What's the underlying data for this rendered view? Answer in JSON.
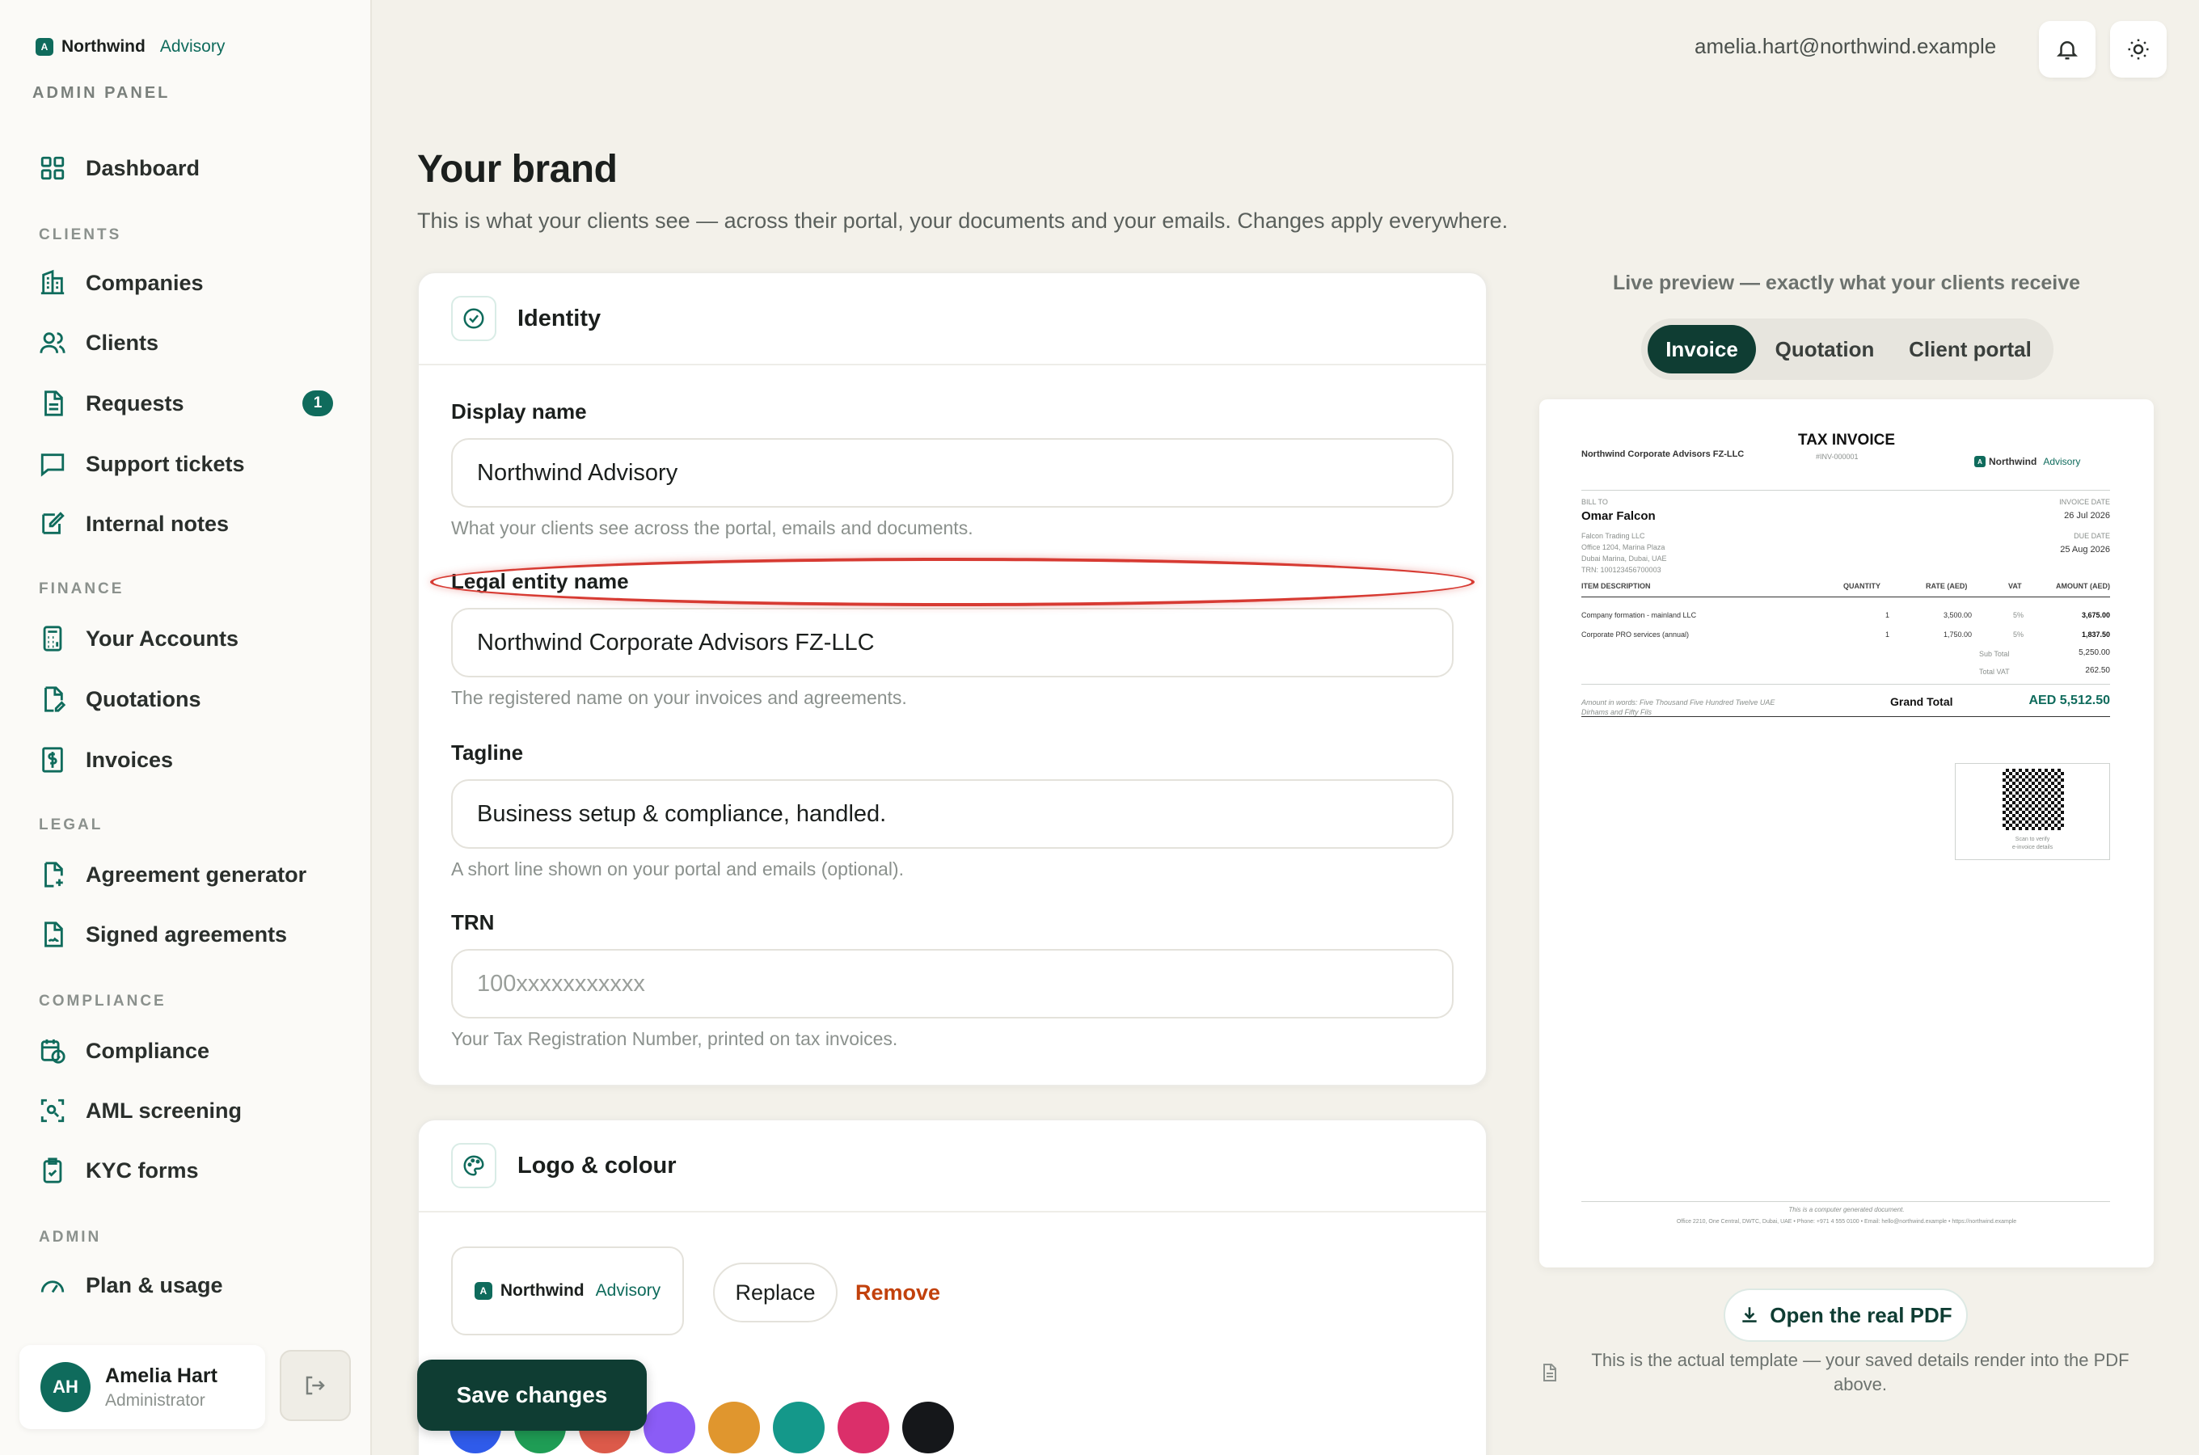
{
  "brand": {
    "logo_letter": "A",
    "name": "Northwind",
    "accent": "Advisory"
  },
  "admin_label": "ADMIN PANEL",
  "sidebar": {
    "dashboard": "Dashboard",
    "sections": {
      "clients": "CLIENTS",
      "finance": "FINANCE",
      "legal": "LEGAL",
      "compliance": "COMPLIANCE",
      "admin": "ADMIN"
    },
    "items": {
      "companies": "Companies",
      "clients": "Clients",
      "requests": "Requests",
      "requests_badge": "1",
      "support_tickets": "Support tickets",
      "internal_notes": "Internal notes",
      "your_accounts": "Your Accounts",
      "quotations": "Quotations",
      "invoices": "Invoices",
      "agreement_generator": "Agreement generator",
      "signed_agreements": "Signed agreements",
      "compliance": "Compliance",
      "aml_screening": "AML screening",
      "kyc_forms": "KYC forms",
      "plan_usage": "Plan & usage"
    }
  },
  "user": {
    "initials": "AH",
    "name": "Amelia Hart",
    "role": "Administrator"
  },
  "topbar": {
    "email": "amelia.hart@northwind.example"
  },
  "page": {
    "title": "Your brand",
    "subtitle": "This is what your clients see — across their portal, your documents and your emails. Changes apply everywhere."
  },
  "identity": {
    "title": "Identity",
    "display_name": {
      "label": "Display name",
      "value": "Northwind Advisory",
      "help": "What your clients see across the portal, emails and documents."
    },
    "legal_name": {
      "label": "Legal entity name",
      "value": "Northwind Corporate Advisors FZ-LLC",
      "help": "The registered name on your invoices and agreements."
    },
    "tagline": {
      "label": "Tagline",
      "value": "Business setup & compliance, handled.",
      "help": "A short line shown on your portal and emails (optional)."
    },
    "trn": {
      "label": "TRN",
      "value": "",
      "placeholder": "100xxxxxxxxxxx",
      "help": "Your Tax Registration Number, printed on tax invoices."
    }
  },
  "logo_colour": {
    "title": "Logo & colour",
    "replace": "Replace",
    "remove": "Remove",
    "swatches": [
      "#2f5bea",
      "#1f9d55",
      "#dc5a4a",
      "#8b5cf6",
      "#e0962e",
      "#14988a",
      "#db2f6a",
      "#15171a"
    ]
  },
  "save_button": "Save changes",
  "preview": {
    "caption": "Live preview — exactly what your clients receive",
    "tabs": {
      "invoice": "Invoice",
      "quotation": "Quotation",
      "client_portal": "Client portal"
    },
    "open_pdf": "Open the real PDF",
    "note": "This is the actual template — your saved details render into the PDF above."
  },
  "invoice_doc": {
    "company": "Northwind Corporate Advisors FZ-LLC",
    "title": "TAX INVOICE",
    "number": "#INV-000001",
    "bill_to_label": "BILL TO",
    "client_name": "Omar Falcon",
    "client_company": "Falcon Trading LLC",
    "client_addr1": "Office 1204, Marina Plaza",
    "client_addr2": "Dubai Marina, Dubai, UAE",
    "client_trn": "TRN: 100123456700003",
    "invoice_date_label": "INVOICE DATE",
    "invoice_date": "26 Jul 2026",
    "due_date_label": "DUE DATE",
    "due_date": "25 Aug 2026",
    "col_item": "ITEM DESCRIPTION",
    "col_qty": "QUANTITY",
    "col_rate": "RATE (AED)",
    "col_vat": "VAT",
    "col_amount": "AMOUNT (AED)",
    "rows": [
      {
        "item": "Company formation - mainland LLC",
        "qty": "1",
        "rate": "3,500.00",
        "vat": "5%",
        "amount": "3,675.00"
      },
      {
        "item": "Corporate PRO services (annual)",
        "qty": "1",
        "rate": "1,750.00",
        "vat": "5%",
        "amount": "1,837.50"
      }
    ],
    "subtotal_label": "Sub Total",
    "subtotal": "5,250.00",
    "vat_label": "Total VAT",
    "vat_total": "262.50",
    "words1": "Amount in words: Five Thousand Five Hundred Twelve UAE",
    "words2": "Dirhams and Fifty Fils",
    "grand_label": "Grand Total",
    "grand_total": "AED 5,512.50",
    "qr_line1": "Scan to verify",
    "qr_line2": "e-invoice details",
    "footer1": "This is a computer generated document.",
    "footer2": "Office 2210, One Central, DWTC, Dubai, UAE • Phone: +971 4 555 0100 • Email: hello@northwind.example • https://northwind.example"
  }
}
